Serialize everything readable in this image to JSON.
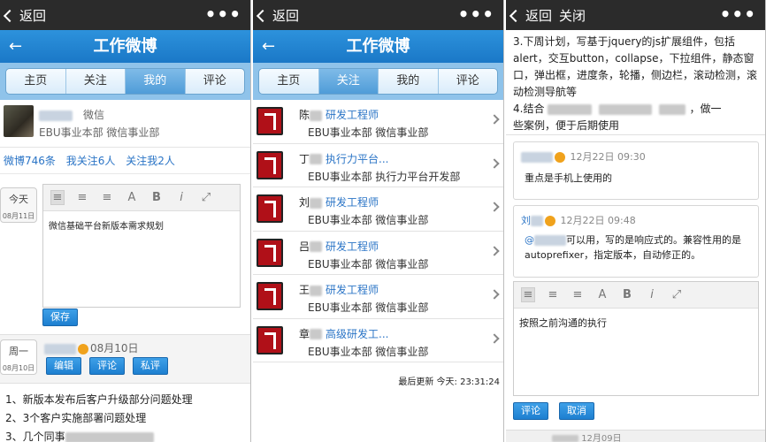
{
  "panels": [
    {
      "topbar": {
        "back_label": "返回",
        "more": "•••"
      },
      "title": "工作微博",
      "tabs": [
        "主页",
        "关注",
        "我的",
        "评论"
      ],
      "active_tab": 2,
      "profile": {
        "name_suffix": "微信",
        "org": "EBU事业本部  微信事业部"
      },
      "stats": {
        "weibo": "微博746条",
        "following": "我关注6人",
        "followers": "关注我2人"
      },
      "compose": {
        "date_label": "今天",
        "date_sub": "08月11日",
        "text": "微信基础平台新版本需求规划",
        "save": "保存"
      },
      "post": {
        "day_label": "周一",
        "day_sub": "08月10日",
        "date": "08月10日",
        "edit": "编辑",
        "comment": "评论",
        "private": "私评"
      },
      "list": [
        "1、新版本发布后客户升级部分问题处理",
        "2、3个客户实施部署问题处理",
        "3、几个同事"
      ]
    },
    {
      "topbar": {
        "back_label": "返回",
        "more": "•••"
      },
      "title": "工作微博",
      "tabs": [
        "主页",
        "关注",
        "我的",
        "评论"
      ],
      "active_tab": 1,
      "users": [
        {
          "surname": "陈",
          "title": "研发工程师",
          "dept": "EBU事业本部 微信事业部"
        },
        {
          "surname": "丁",
          "title": "执行力平台...",
          "dept": "EBU事业本部 执行力平台开发部"
        },
        {
          "surname": "刘",
          "title": "研发工程师",
          "dept": "EBU事业本部 微信事业部"
        },
        {
          "surname": "吕",
          "title": "研发工程师",
          "dept": "EBU事业本部 微信事业部"
        },
        {
          "surname": "王",
          "title": "研发工程师",
          "dept": "EBU事业本部 微信事业部"
        },
        {
          "surname": "章",
          "title": "高级研发工...",
          "dept": "EBU事业本部 微信事业部"
        }
      ],
      "updated": "最后更新 今天:  23:31:24"
    },
    {
      "topbar": {
        "back_label": "返回",
        "close_label": "关闭",
        "more": "•••"
      },
      "content": {
        "line1": "3.下周计划，写基于jquery的js扩展组件，包括alert，交互button，collapse，下拉组件，静态窗口，弹出框，进度条，轮播，侧边栏，滚动检测，滚动检测导航等",
        "line2a": "4.结合",
        "line2b": "，做一",
        "line2c": "些案例，便于后期使用"
      },
      "comments": [
        {
          "date": "12月22日 09:30",
          "text": "重点是手机上使用的"
        },
        {
          "name": "刘",
          "date": "12月22日 09:48",
          "at": "@",
          "text": "可以用，写的是响应式的。兼容性用的是autoprefixer，指定版本，自动修正的。"
        }
      ],
      "reply": {
        "text": "按照之前沟通的执行",
        "comment": "评论",
        "cancel": "取消"
      },
      "footer_date": "12月09日"
    }
  ]
}
